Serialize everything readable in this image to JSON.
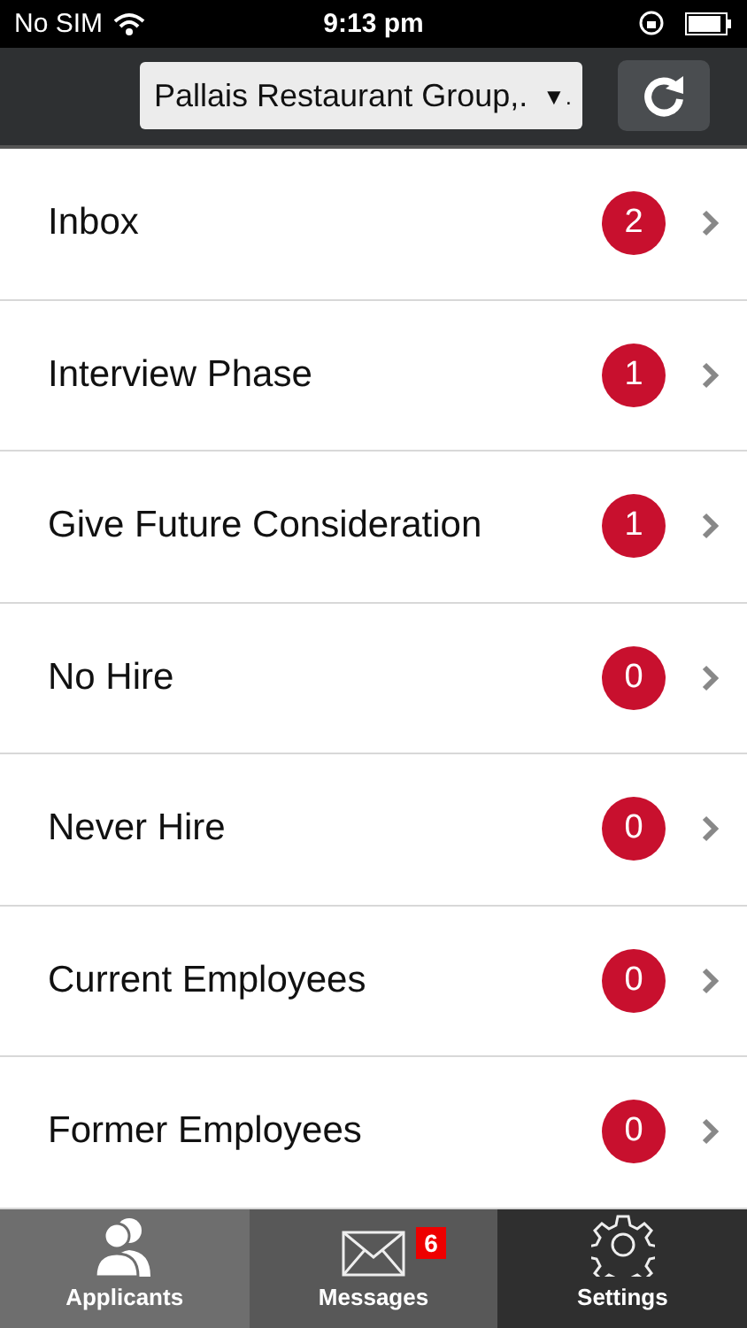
{
  "status_bar": {
    "carrier": "No SIM",
    "time": "9:13 pm"
  },
  "toolbar": {
    "dropdown": {
      "value": "Pallais Restaurant Group,.",
      "arrow": "▼."
    }
  },
  "list": [
    {
      "label": "Inbox",
      "count": "2"
    },
    {
      "label": "Interview Phase",
      "count": "1"
    },
    {
      "label": "Give Future Consideration",
      "count": "1"
    },
    {
      "label": "No Hire",
      "count": "0"
    },
    {
      "label": "Never Hire",
      "count": "0"
    },
    {
      "label": "Current Employees",
      "count": "0"
    },
    {
      "label": "Former Employees",
      "count": "0"
    }
  ],
  "tab_bar": [
    {
      "label": "Applicants",
      "kind": "people",
      "selected": true
    },
    {
      "label": "Messages",
      "kind": "mail",
      "selected": false,
      "badge": "6"
    },
    {
      "label": "Settings",
      "kind": "gear",
      "selected": false
    }
  ]
}
